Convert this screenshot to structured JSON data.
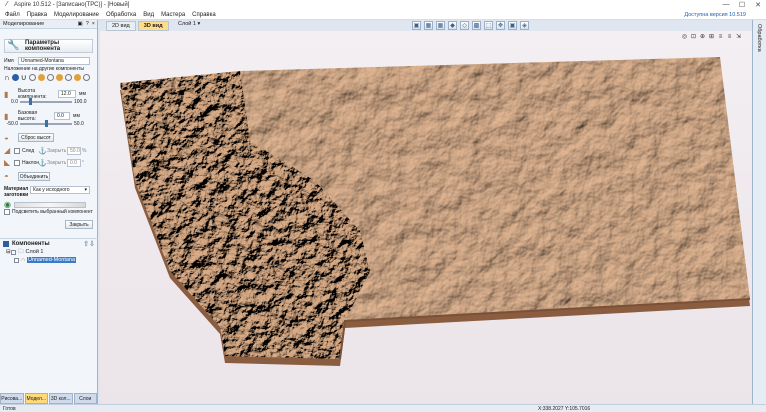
{
  "window": {
    "title": "Aspire 10.512 - [Записано(ТРС)] - [Новый]",
    "controls": [
      "—",
      "☐",
      "✕"
    ]
  },
  "menu": {
    "items": [
      "Файл",
      "Правка",
      "Моделирование",
      "Обработка",
      "Вид",
      "Мастера",
      "Справка"
    ],
    "update_link": "Доступна версия 10.519"
  },
  "left_panel": {
    "header": "Моделирование",
    "header_icons": [
      "▣",
      "?",
      "×"
    ],
    "params_title": "Параметры компонента",
    "name_label": "Имя",
    "name_value": "Unnamed-Montana",
    "overlay_label": "Наложение на другие компоненты",
    "height_label": "Высота компонента:",
    "height_value": "12.0",
    "height_unit": "мм",
    "height_min": "0.0",
    "height_max": "100.0",
    "base_label": "Базовая высота:",
    "base_value": "0.0",
    "base_unit": "мм",
    "base_min": "-50.0",
    "base_max": "50.0",
    "reset_height_button": "Сброс высот",
    "fade_label": "След",
    "tilt_label": "Наклон",
    "lock_label": "Закрыть",
    "fade_value": "50.0",
    "tilt_value": "0.0",
    "fade_unit": "%",
    "tilt_unit": "°",
    "merge_button": "Объединить",
    "material_label": "Материал заготовки",
    "material_option": "Как у исходного",
    "transfer_label": "Подсветить выбранный компонент",
    "close_button": "Закрыть",
    "components_title": "Компоненты",
    "layer_name": "Слой 1",
    "component_name": "Unnamed-Montana",
    "bottom_tabs": [
      "Рисова...",
      "Модел...",
      "3D кол...",
      "Слои"
    ],
    "active_tab_index": 1
  },
  "view": {
    "tabs": [
      "2D вид",
      "3D вид"
    ],
    "active_tab": "3D вид",
    "layer_select": "Слой 1 ▾",
    "toolbar_icons": [
      "▣",
      "▦",
      "▦",
      "◆",
      "◇",
      "▩",
      "⬚",
      "✥",
      "▣",
      "◈"
    ],
    "view_icons": [
      "◎",
      "⊡",
      "⊕",
      "⊞",
      "≡",
      "≡",
      "⇲"
    ],
    "right_strip_label": "Обработка"
  },
  "status": {
    "left": "Готов",
    "coords": "X:338.2027 Y:105.7016"
  },
  "colors": {
    "relief_light": "#d7ac8c",
    "relief_mid": "#c4946f",
    "relief_dark": "#8a5d40",
    "relief_edge": "#a97a58",
    "background": "#f0eaee"
  }
}
